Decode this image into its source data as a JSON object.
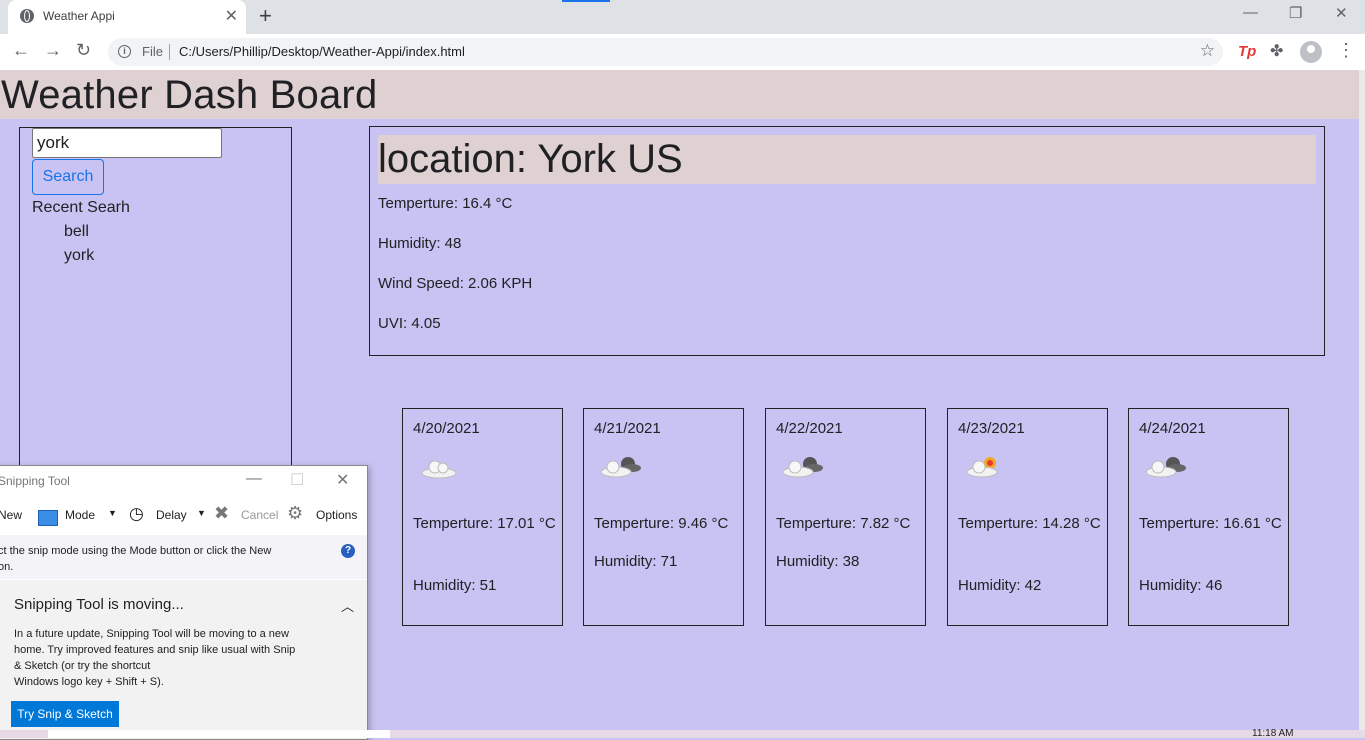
{
  "browser": {
    "tab_title": "Weather Appi",
    "tab_close": "✕",
    "new_tab": "+",
    "file_label": "File",
    "url": "C:/Users/Phillip/Desktop/Weather-Appi/index.html",
    "ext_tp": "Tp"
  },
  "page": {
    "title": "Weather Dash Board",
    "search": {
      "value": "york",
      "button": "Search"
    },
    "recent_title": "Recent Searh",
    "recent": [
      "bell",
      "york"
    ],
    "current": {
      "location": "location: York US",
      "temp": "Temperture: 16.4 °C",
      "humidity": "Humidity: 48",
      "wind": "Wind Speed: 2.06 KPH",
      "uvi": "UVI: 4.05"
    },
    "forecast": [
      {
        "date": "4/20/2021",
        "icon": "cloud-icon",
        "temp": "Temperture: 17.01 °C",
        "humidity": "Humidity: 51"
      },
      {
        "date": "4/21/2021",
        "icon": "broken-clouds-icon",
        "temp": "Temperture: 9.46 °C",
        "humidity": "Humidity: 71"
      },
      {
        "date": "4/22/2021",
        "icon": "broken-clouds-icon",
        "temp": "Temperture: 7.82 °C",
        "humidity": "Humidity: 38"
      },
      {
        "date": "4/23/2021",
        "icon": "sun-cloud-icon",
        "temp": "Temperture: 14.28 °C",
        "humidity": "Humidity: 42"
      },
      {
        "date": "4/24/2021",
        "icon": "broken-clouds-icon",
        "temp": "Temperture: 16.61 °C",
        "humidity": "Humidity: 46"
      }
    ]
  },
  "snipping_tool": {
    "title": "Snipping Tool",
    "new": "New",
    "mode": "Mode",
    "delay": "Delay",
    "cancel": "Cancel",
    "options": "Options",
    "hint_line1": "ct the snip mode using the Mode button or click the New",
    "hint_line2": "on.",
    "notice_title": "Snipping Tool is moving...",
    "notice_text_1": "In a future update, Snipping Tool will be moving to a new",
    "notice_text_2": "home. Try improved features and snip like usual with Snip",
    "notice_text_3": "& Sketch (or try the shortcut",
    "notice_text_4": "Windows logo key + Shift + S).",
    "try_button": "Try Snip & Sketch"
  },
  "taskbar": {
    "time": "11:18 AM"
  }
}
